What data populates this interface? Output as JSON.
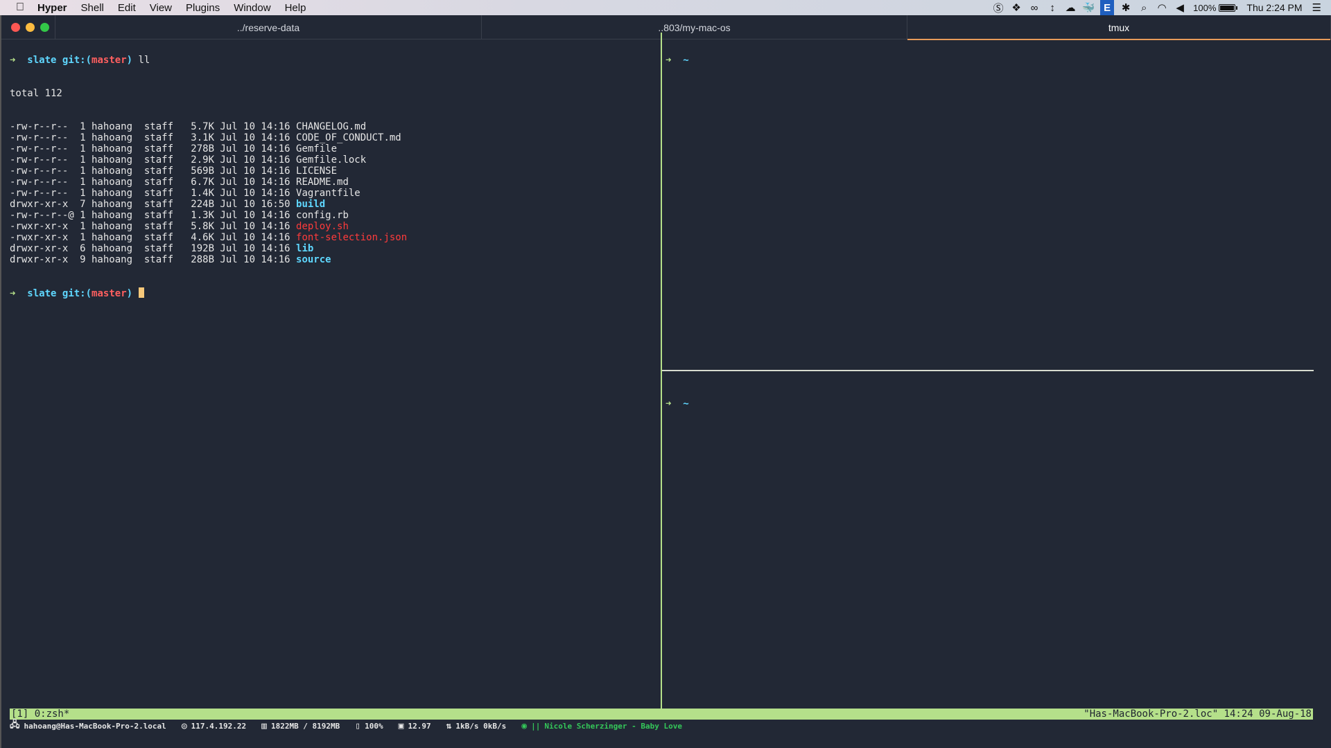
{
  "menubar": {
    "apple_icon": "",
    "items": [
      "Hyper",
      "Shell",
      "Edit",
      "View",
      "Plugins",
      "Window",
      "Help"
    ],
    "tray_icons": [
      "skype-icon",
      "dropbox-icon",
      "creative-cloud-icon",
      "sync-arrows-icon",
      "onedrive-icon",
      "docker-icon",
      "e-icon",
      "bluetooth-icon",
      "search-icon",
      "wifi-icon",
      "volume-icon"
    ],
    "e_label": "E",
    "battery_percent": "100%",
    "battery_level": 1.0,
    "clock": "Thu 2:24 PM",
    "list_icon": "☰"
  },
  "tabs": [
    {
      "label": "../reserve-data",
      "active": false
    },
    {
      "label": "..803/my-mac-os",
      "active": false
    },
    {
      "label": "tmux",
      "active": true
    }
  ],
  "left_pane": {
    "prompt_arrow": "➜",
    "dir": "slate",
    "git_prefix": "git:(",
    "branch": "master",
    "git_suffix": ")",
    "command": "ll",
    "total": "total 112",
    "files": [
      {
        "perms": "-rw-r--r--",
        "links": "1",
        "owner": "hahoang",
        "group": "staff",
        "size": "5.7K",
        "date": "Jul 10 14:16",
        "name": "CHANGELOG.md",
        "type": "file"
      },
      {
        "perms": "-rw-r--r--",
        "links": "1",
        "owner": "hahoang",
        "group": "staff",
        "size": "3.1K",
        "date": "Jul 10 14:16",
        "name": "CODE_OF_CONDUCT.md",
        "type": "file"
      },
      {
        "perms": "-rw-r--r--",
        "links": "1",
        "owner": "hahoang",
        "group": "staff",
        "size": "278B",
        "date": "Jul 10 14:16",
        "name": "Gemfile",
        "type": "file"
      },
      {
        "perms": "-rw-r--r--",
        "links": "1",
        "owner": "hahoang",
        "group": "staff",
        "size": "2.9K",
        "date": "Jul 10 14:16",
        "name": "Gemfile.lock",
        "type": "file"
      },
      {
        "perms": "-rw-r--r--",
        "links": "1",
        "owner": "hahoang",
        "group": "staff",
        "size": "569B",
        "date": "Jul 10 14:16",
        "name": "LICENSE",
        "type": "file"
      },
      {
        "perms": "-rw-r--r--",
        "links": "1",
        "owner": "hahoang",
        "group": "staff",
        "size": "6.7K",
        "date": "Jul 10 14:16",
        "name": "README.md",
        "type": "file"
      },
      {
        "perms": "-rw-r--r--",
        "links": "1",
        "owner": "hahoang",
        "group": "staff",
        "size": "1.4K",
        "date": "Jul 10 14:16",
        "name": "Vagrantfile",
        "type": "file"
      },
      {
        "perms": "drwxr-xr-x",
        "links": "7",
        "owner": "hahoang",
        "group": "staff",
        "size": "224B",
        "date": "Jul 10 16:50",
        "name": "build",
        "type": "dir"
      },
      {
        "perms": "-rw-r--r--@",
        "links": "1",
        "owner": "hahoang",
        "group": "staff",
        "size": "1.3K",
        "date": "Jul 10 14:16",
        "name": "config.rb",
        "type": "file"
      },
      {
        "perms": "-rwxr-xr-x",
        "links": "1",
        "owner": "hahoang",
        "group": "staff",
        "size": "5.8K",
        "date": "Jul 10 14:16",
        "name": "deploy.sh",
        "type": "exec"
      },
      {
        "perms": "-rwxr-xr-x",
        "links": "1",
        "owner": "hahoang",
        "group": "staff",
        "size": "4.6K",
        "date": "Jul 10 14:16",
        "name": "font-selection.json",
        "type": "exec"
      },
      {
        "perms": "drwxr-xr-x",
        "links": "6",
        "owner": "hahoang",
        "group": "staff",
        "size": "192B",
        "date": "Jul 10 14:16",
        "name": "lib",
        "type": "dir"
      },
      {
        "perms": "drwxr-xr-x",
        "links": "9",
        "owner": "hahoang",
        "group": "staff",
        "size": "288B",
        "date": "Jul 10 14:16",
        "name": "source",
        "type": "dir"
      }
    ]
  },
  "right_top_pane": {
    "prompt_arrow": "➜",
    "dir": "~"
  },
  "right_bottom_pane": {
    "prompt_arrow": "➜",
    "dir": "~"
  },
  "tmux_status": {
    "left": "[1] 0:zsh*",
    "right": "\"Has-MacBook-Pro-2.loc\" 14:24 09-Aug-18"
  },
  "system_bar": {
    "host": "hahoang@Has-MacBook-Pro-2.local",
    "ip": "117.4.192.22",
    "memory": "1822MB / 8192MB",
    "battery": "100%",
    "load": "12.97",
    "network": "1kB/s 0kB/s",
    "music_status": "||",
    "music": "Nicole Scherzinger - Baby Love"
  }
}
